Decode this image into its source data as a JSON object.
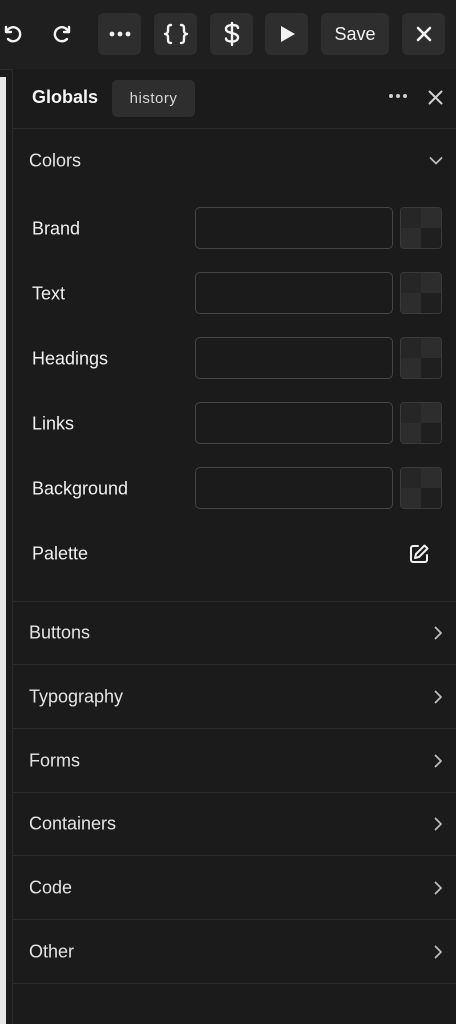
{
  "toolbar": {
    "undo_icon": "undo-icon",
    "redo_icon": "redo-icon",
    "more_icon": "ellipsis-icon",
    "code_icon": "braces-icon",
    "variables_icon": "dollar-icon",
    "run_icon": "play-icon",
    "save_label": "Save",
    "close_icon": "close-icon"
  },
  "panel": {
    "title": "Globals",
    "history_label": "history",
    "more_icon": "ellipsis-icon",
    "close_icon": "close-icon"
  },
  "colors": {
    "label": "Colors",
    "expanded": true,
    "fields": [
      {
        "label": "Brand",
        "value": ""
      },
      {
        "label": "Text",
        "value": ""
      },
      {
        "label": "Headings",
        "value": ""
      },
      {
        "label": "Links",
        "value": ""
      },
      {
        "label": "Background",
        "value": ""
      }
    ],
    "palette_label": "Palette",
    "palette_icon": "edit-icon"
  },
  "sections": [
    {
      "label": "Buttons"
    },
    {
      "label": "Typography"
    },
    {
      "label": "Forms"
    },
    {
      "label": "Containers"
    },
    {
      "label": "Code"
    },
    {
      "label": "Other"
    }
  ],
  "theme": {
    "background": "#1b1b1b",
    "button_bg": "#2e2e2e",
    "border": "#2c2c2c",
    "text": "#e9e9e9"
  }
}
